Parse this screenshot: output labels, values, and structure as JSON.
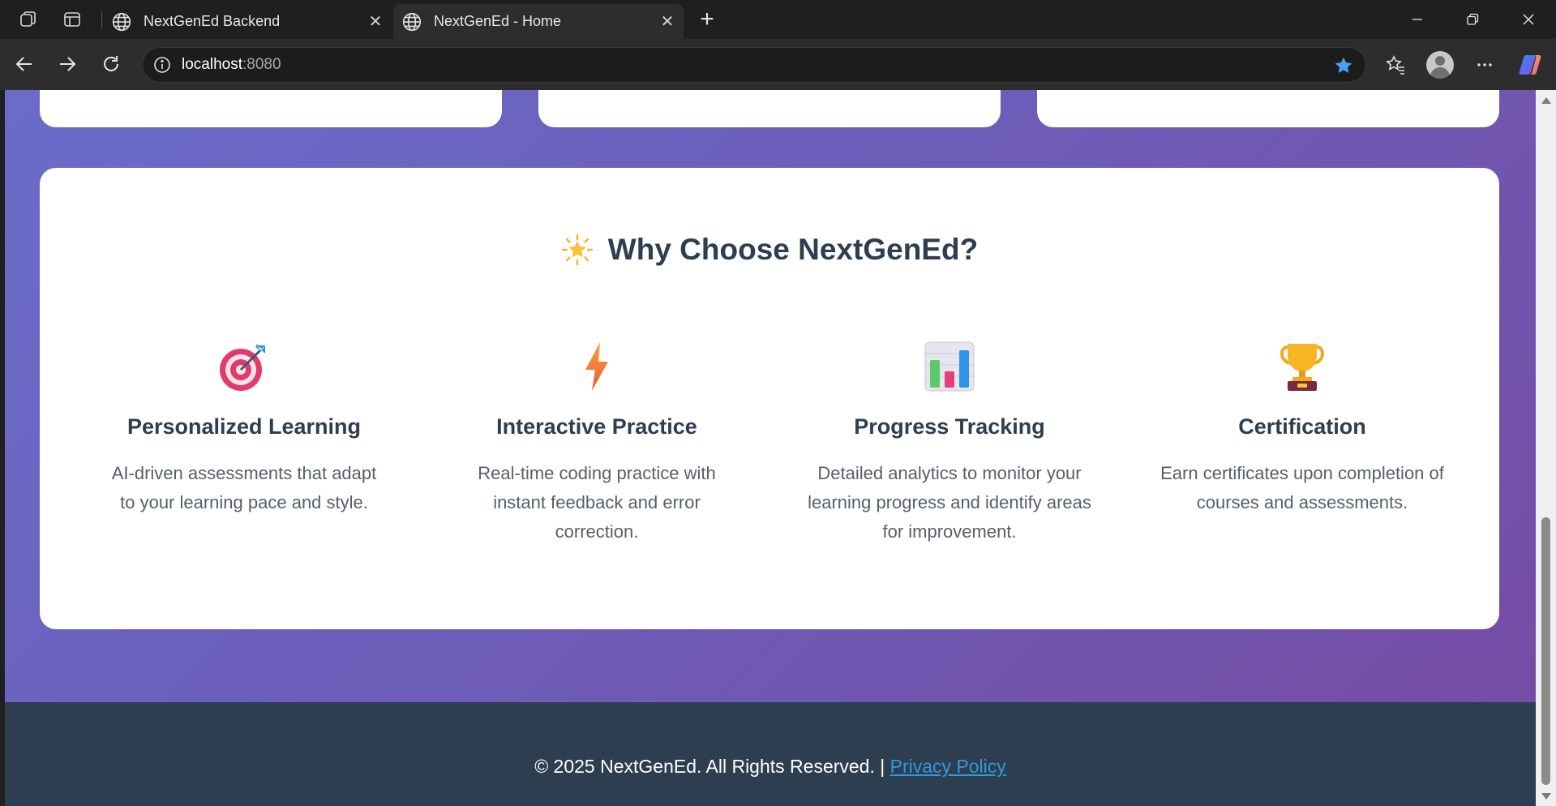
{
  "browser": {
    "tabs": [
      {
        "title": "NextGenEd Backend",
        "active": false
      },
      {
        "title": "NextGenEd - Home",
        "active": true
      }
    ],
    "address": {
      "host": "localhost",
      "port": ":8080"
    }
  },
  "features_section": {
    "title_icon": "glowing-star-emoji",
    "title": "Why Choose NextGenEd?",
    "items": [
      {
        "icon": "target-emoji",
        "title": "Personalized Learning",
        "description": "AI-driven assessments that adapt to your learning pace and style."
      },
      {
        "icon": "lightning-emoji",
        "title": "Interactive Practice",
        "description": "Real-time coding practice with instant feedback and error correction."
      },
      {
        "icon": "bar-chart-emoji",
        "title": "Progress Tracking",
        "description": "Detailed analytics to monitor your learning progress and identify areas for improvement."
      },
      {
        "icon": "trophy-emoji",
        "title": "Certification",
        "description": "Earn certificates upon completion of courses and assessments."
      }
    ]
  },
  "footer": {
    "copyright": "© 2025 NextGenEd. All Rights Reserved. |",
    "privacy_link": "Privacy Policy"
  },
  "colors": {
    "gradient_start": "#667eea",
    "gradient_end": "#764ba2",
    "heading": "#2c3e50",
    "footer_bg": "#2c3e50",
    "link": "#3498db"
  }
}
